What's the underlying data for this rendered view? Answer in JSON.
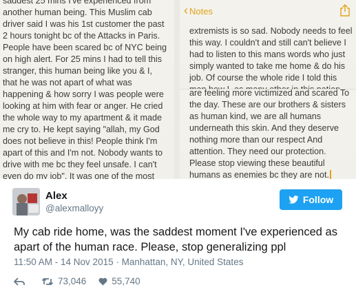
{
  "notes": {
    "left_lines": [
      "saddest 25 mins I've experienced from",
      "another human being. This Muslim cab",
      "driver said I was his 1st customer the past",
      "2 hours tonight bc of the Attacks in Paris.",
      "People have been scared bc of NYC being",
      "on high alert. For 25 mins I had to tell this",
      "stranger, this human being like you & I,",
      "that he was not apart of what was",
      "happening & how sorry I was people were",
      "looking at him with fear or anger. He cried",
      "the whole way to my apartment & it made",
      "me cry to. He kept saying \"allah, my God",
      "does not believe in this! People think I'm",
      "apart of this and I'm not. Nobody wants to",
      "drive with me bc they feel unsafe. I can't",
      "even do my job\". It was one of the most"
    ],
    "back_label": "Notes",
    "back_chevron": "‹",
    "right_top_lines": [
      "extremists is so sad. Nobody needs to feel",
      "this way. I couldn't and still can't believe I",
      "had to listen to this mans words who just",
      "simply wanted to take me home & do his",
      "job. Of course the whole ride I told this",
      "man how I, as many other in this nation"
    ],
    "right_bottom_lines": [
      "are feeling more victimized and scared To",
      "the day. These are our brothers & sisters",
      "as human kind, we are all humans",
      "underneath this skin. And they deserve",
      "nothing more than our respect And",
      "attention. They need our protection.",
      "Please stop viewing these beautiful",
      "humans as enemies bc they are not."
    ],
    "accent_color": "#e0a318",
    "share_icon": "share-icon"
  },
  "tweet": {
    "name": "Alex",
    "handle": "@alexmalloyy",
    "follow_label": "Follow",
    "text": "My cab ride home, was the saddest moment I've experienced as apart of the human race. Please, stop generalizing ppl",
    "timestamp": "11:50 AM - 14 Nov 2015 · Manhattan, NY, United States",
    "retweets": "73,046",
    "likes": "55,740",
    "brand_color": "#1da1f2",
    "icons": [
      "reply-icon",
      "retweet-icon",
      "heart-icon",
      "twitter-bird-icon"
    ]
  }
}
